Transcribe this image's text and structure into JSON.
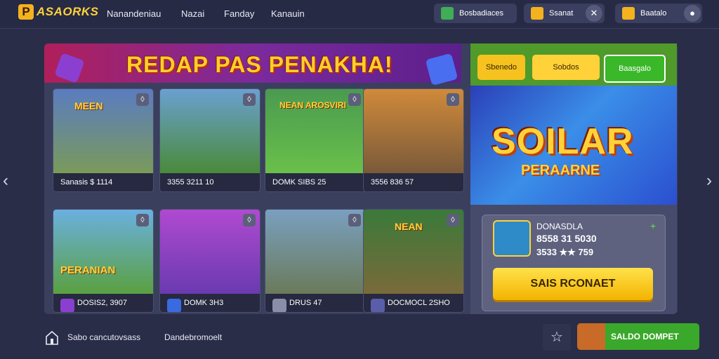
{
  "app": {
    "logo_letter": "P",
    "logo_text": "ASAORKS"
  },
  "nav": [
    "Nanandeniau",
    "Nazai",
    "Fanday",
    "Kanauin"
  ],
  "top_pills": [
    {
      "label": "Bosbadiaces"
    },
    {
      "label": "Ssanat"
    },
    {
      "label": "Baatalo"
    }
  ],
  "banner": {
    "title": "REDAP PAS PENAKHA!"
  },
  "cards": [
    {
      "overlay": "MEEN",
      "caption": "Sanasis $ 1114"
    },
    {
      "overlay": "",
      "caption": "3355 3211 10"
    },
    {
      "overlay": "NEAN AROSVIRI",
      "caption": "DOMK SIBS 25"
    },
    {
      "overlay": "",
      "caption": "3556 836 57"
    },
    {
      "overlay": "PERANIAN",
      "caption": "DOSIS2, 3907"
    },
    {
      "overlay": "",
      "caption": "DOMK 3H3"
    },
    {
      "overlay": "",
      "caption": "DRUS 47"
    },
    {
      "overlay": "NEAN",
      "caption": "DOCMOCL 2SHO"
    }
  ],
  "right_tabs": [
    {
      "label": "Sbenedo"
    },
    {
      "label": "Sobdos"
    },
    {
      "label": "Baasgalo"
    }
  ],
  "hero": {
    "title": "SOILAR",
    "subtitle": "PERAARNE"
  },
  "info": {
    "line1": "DONASDLA",
    "line2": "8558 31 5030",
    "line3": "3533 ★★ 759",
    "plus": "+"
  },
  "cta": {
    "label": "SAIS RCONAET"
  },
  "footer": {
    "left1": "Sabo cancutovsass",
    "left2": "Dandebromoelt",
    "saldo": "SALDO DOMPET"
  },
  "colors": {
    "accent": "#ffd23a",
    "cta": "#f2b400",
    "green": "#3aa82a",
    "panel": "#3b3f5e"
  },
  "icons": [
    "bank-icon",
    "chevron-left-icon",
    "chevron-right-icon",
    "star-icon",
    "chest-icon"
  ]
}
